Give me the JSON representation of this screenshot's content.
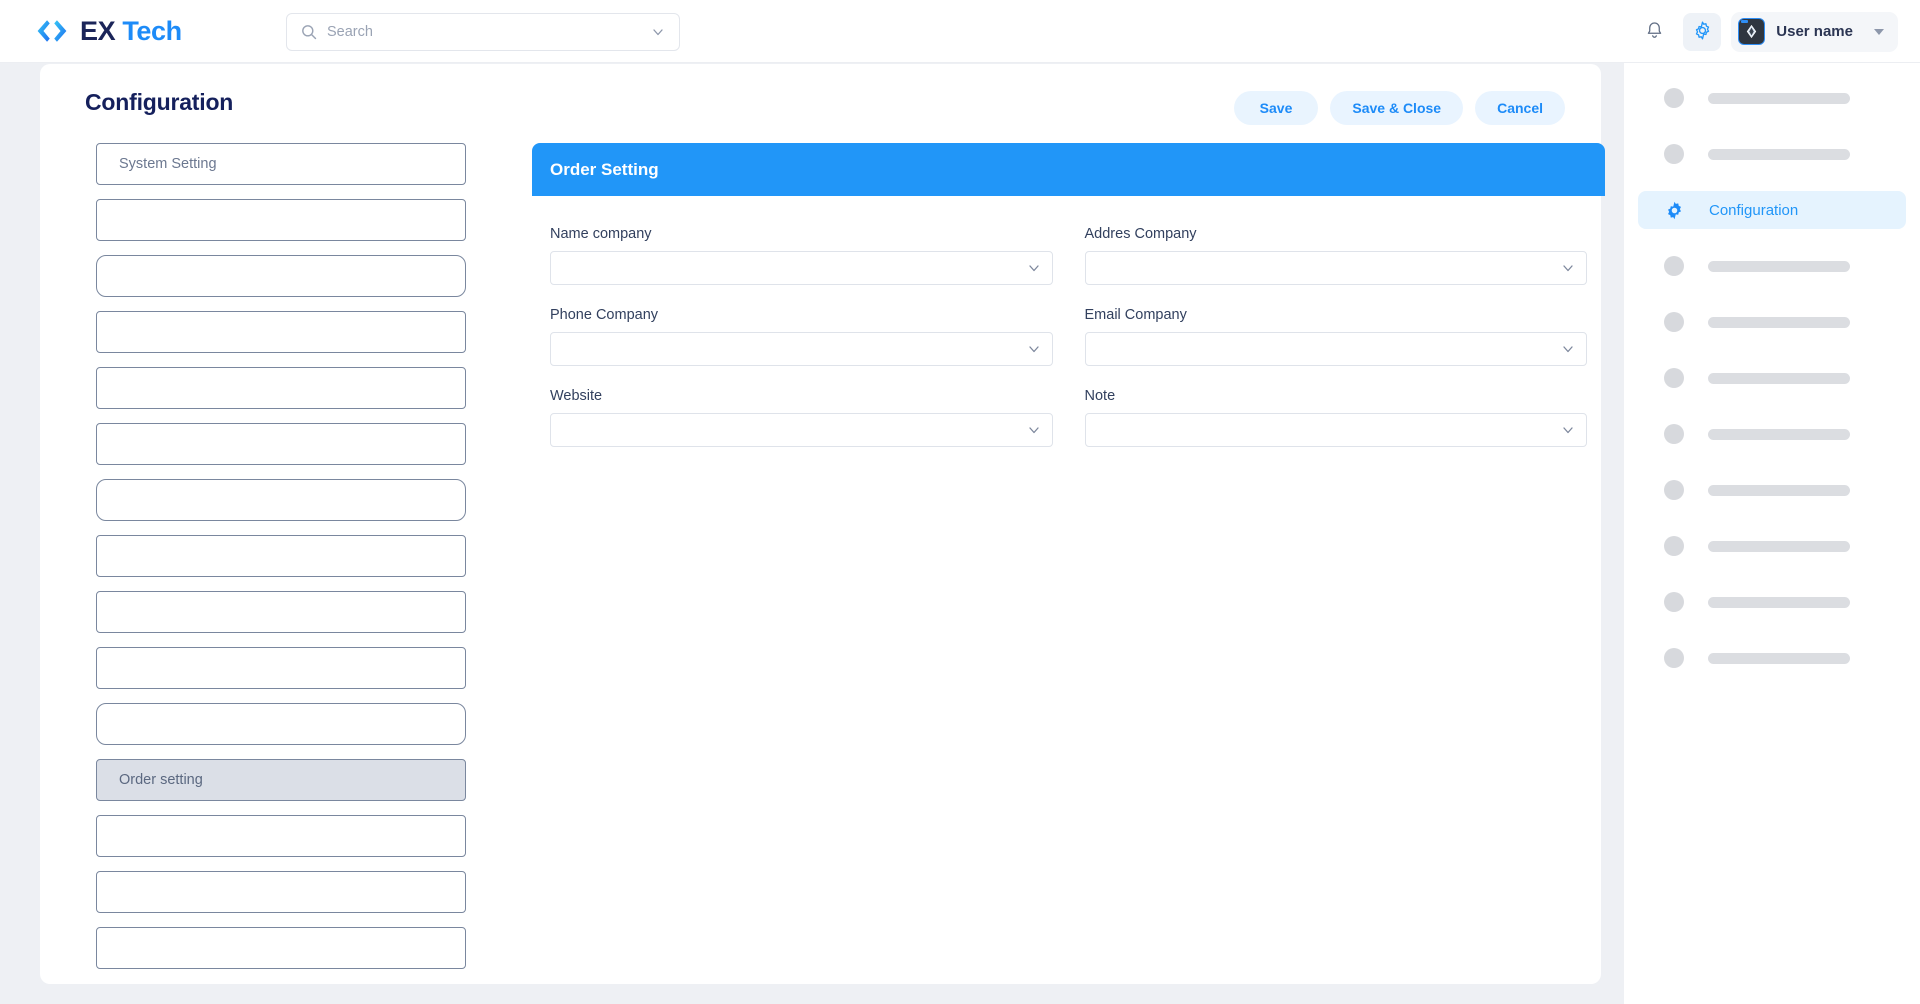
{
  "brand": {
    "logo_icon": "code-brackets-icon",
    "name_primary": "EX",
    "name_secondary": "Tech"
  },
  "topbar": {
    "search": {
      "icon": "search-icon",
      "placeholder": "Search",
      "value": "",
      "chevron_icon": "chevron-down-icon"
    },
    "notifications_icon": "bell-icon",
    "settings_icon": "gear-icon",
    "user": {
      "avatar_icon": "diamond-avatar-icon",
      "name": "User name",
      "caret_icon": "caret-down-icon"
    }
  },
  "page": {
    "title": "Configuration",
    "actions": [
      {
        "label": "Save",
        "name": "save-button"
      },
      {
        "label": "Save & Close",
        "name": "save-and-close-button"
      },
      {
        "label": "Cancel",
        "name": "cancel-button"
      }
    ]
  },
  "settings_list": [
    {
      "label": "System Setting",
      "selected": false,
      "rounded": false
    },
    {
      "label": "",
      "selected": false,
      "rounded": false
    },
    {
      "label": "",
      "selected": false,
      "rounded": true
    },
    {
      "label": "",
      "selected": false,
      "rounded": false
    },
    {
      "label": "",
      "selected": false,
      "rounded": false
    },
    {
      "label": "",
      "selected": false,
      "rounded": false
    },
    {
      "label": "",
      "selected": false,
      "rounded": true
    },
    {
      "label": "",
      "selected": false,
      "rounded": false
    },
    {
      "label": "",
      "selected": false,
      "rounded": false
    },
    {
      "label": "",
      "selected": false,
      "rounded": false
    },
    {
      "label": "",
      "selected": false,
      "rounded": true
    },
    {
      "label": "Order setting",
      "selected": true,
      "rounded": false
    },
    {
      "label": "",
      "selected": false,
      "rounded": false
    },
    {
      "label": "",
      "selected": false,
      "rounded": false
    },
    {
      "label": "",
      "selected": false,
      "rounded": false
    }
  ],
  "form_panel": {
    "header_title": "Order Setting",
    "rows": [
      [
        {
          "label": "Name company",
          "value": "",
          "name": "name-company-select"
        },
        {
          "label": "Addres Company",
          "value": "",
          "name": "addres-company-select"
        }
      ],
      [
        {
          "label": "Phone Company",
          "value": "",
          "name": "phone-company-select"
        },
        {
          "label": "Email Company",
          "value": "",
          "name": "email-company-select"
        }
      ],
      [
        {
          "label": "Website",
          "value": "",
          "name": "website-select"
        },
        {
          "label": "Note",
          "value": "",
          "name": "note-select"
        }
      ]
    ]
  },
  "right_nav": {
    "items": [
      {
        "type": "skeleton",
        "label": ""
      },
      {
        "type": "skeleton",
        "label": ""
      },
      {
        "type": "link",
        "label": "Configuration",
        "icon": "gear-icon",
        "active": true
      },
      {
        "type": "skeleton",
        "label": ""
      },
      {
        "type": "skeleton",
        "label": ""
      },
      {
        "type": "skeleton",
        "label": ""
      },
      {
        "type": "skeleton",
        "label": ""
      },
      {
        "type": "skeleton",
        "label": ""
      },
      {
        "type": "skeleton",
        "label": ""
      },
      {
        "type": "skeleton",
        "label": ""
      },
      {
        "type": "skeleton",
        "label": ""
      }
    ]
  },
  "colors": {
    "accent_blue": "#2196f8",
    "logo_navy": "#1b2559",
    "panel_header": "#2196f8",
    "active_nav_bg": "#e5f3fe",
    "pill_bg": "#e9f4ff",
    "selected_row_bg": "#dbdfe7",
    "page_bg": "#eef0f4"
  }
}
